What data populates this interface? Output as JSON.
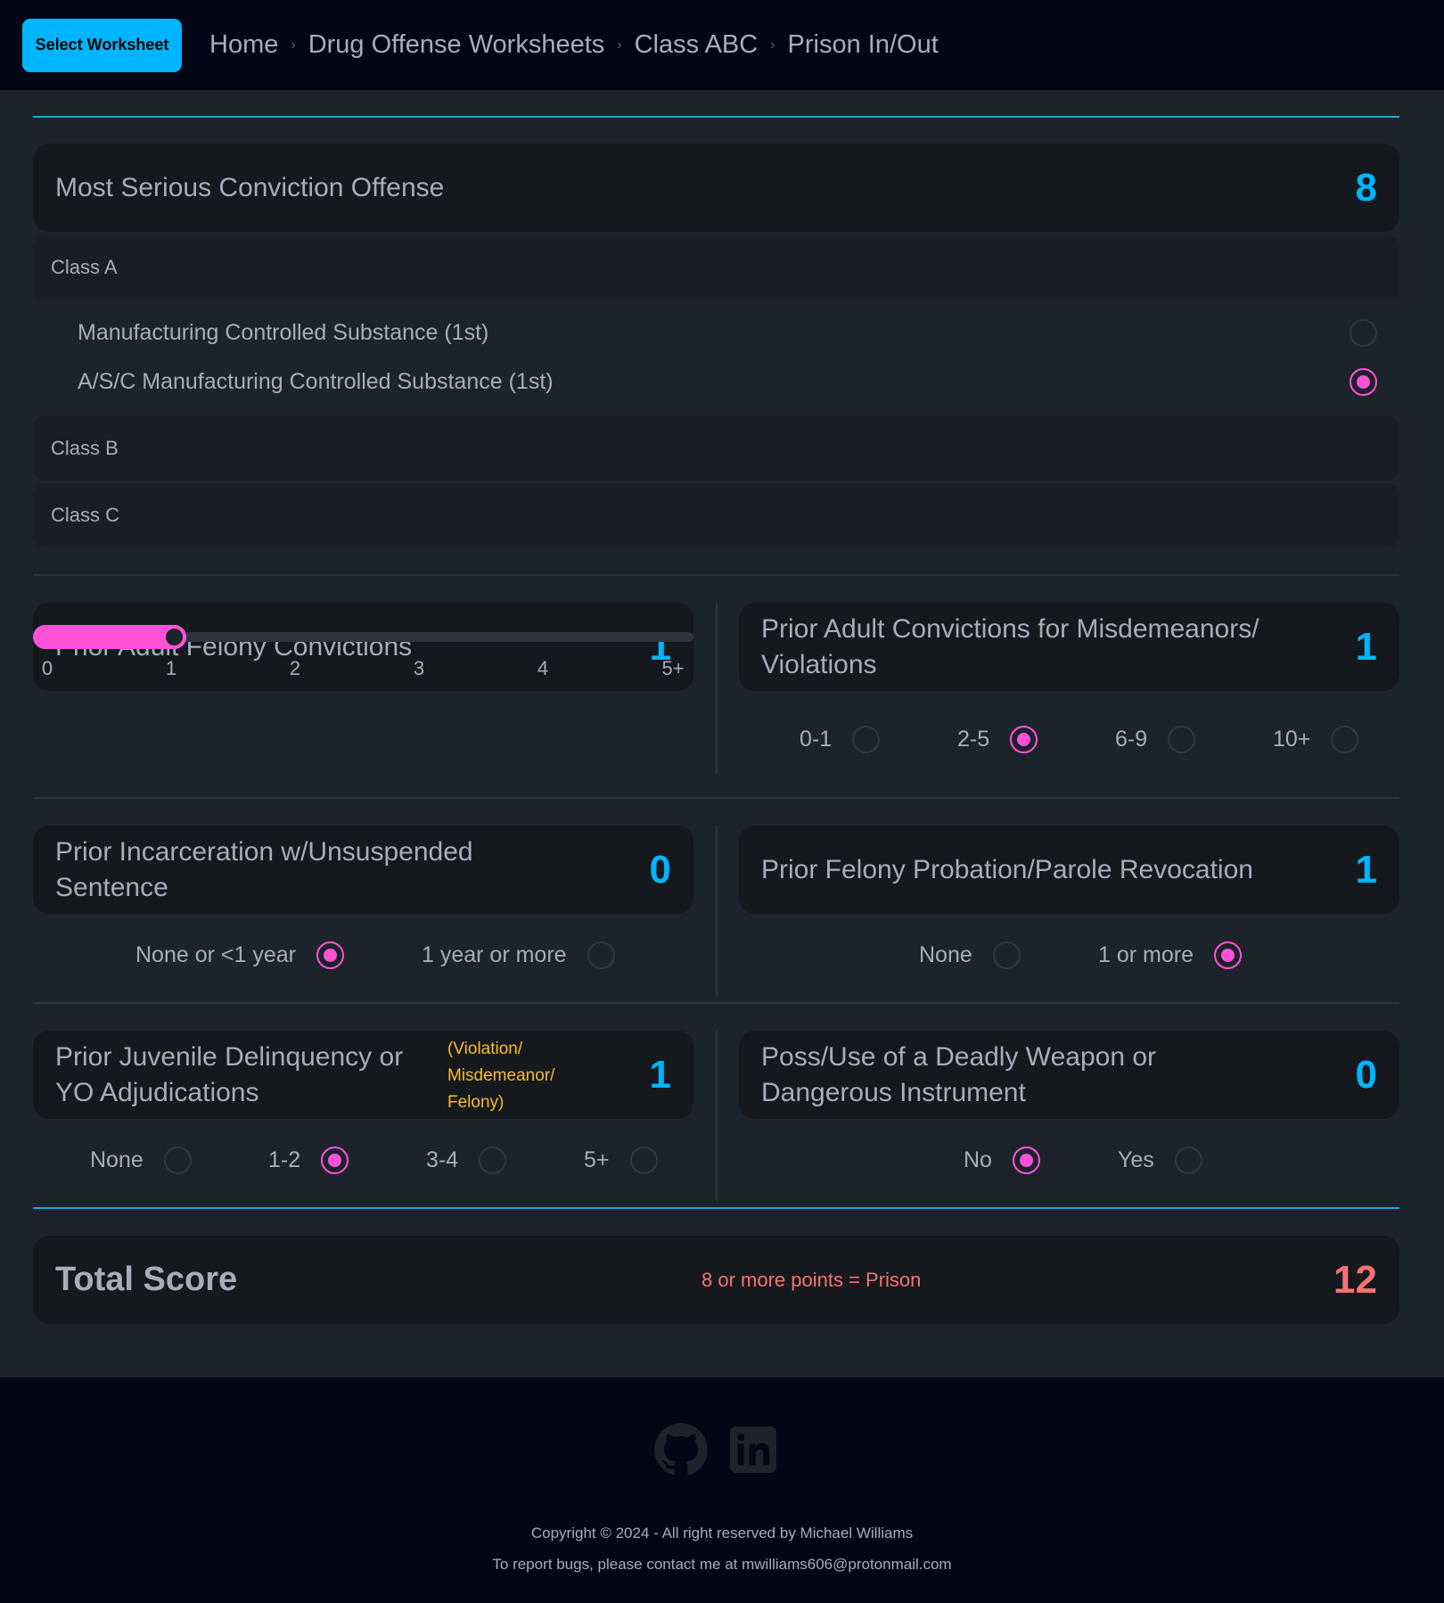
{
  "nav": {
    "select_button": "Select Worksheet",
    "breadcrumbs": [
      "Home",
      "Drug Offense Worksheets",
      "Class ABC",
      "Prison In/Out"
    ]
  },
  "offense": {
    "title": "Most Serious Conviction Offense",
    "score": "8",
    "classes": [
      {
        "label": "Class A",
        "options": [
          {
            "label": "Manufacturing Controlled Substance (1st)",
            "selected": false
          },
          {
            "label": "A/S/C Manufacturing Controlled Substance (1st)",
            "selected": true
          }
        ]
      },
      {
        "label": "Class B"
      },
      {
        "label": "Class C"
      }
    ]
  },
  "felony": {
    "title": "Prior Adult Felony Convictions",
    "score": "1",
    "ticks": [
      "0",
      "1",
      "2",
      "3",
      "4",
      "5+"
    ],
    "value_index": 1
  },
  "misdemeanor": {
    "title": "Prior Adult Convictions for Misdemeanors/ Violations",
    "score": "1",
    "options": [
      "0-1",
      "2-5",
      "6-9",
      "10+"
    ],
    "selected": "2-5"
  },
  "incarceration": {
    "title": "Prior Incarceration w/Unsuspended Sentence",
    "score": "0",
    "options": [
      "None or <1 year",
      "1 year or more"
    ],
    "selected": "None or <1 year"
  },
  "revocation": {
    "title": "Prior Felony Probation/Parole Revocation",
    "score": "1",
    "options": [
      "None",
      "1 or more"
    ],
    "selected": "1 or more"
  },
  "juvenile": {
    "title": "Prior Juvenile Delinquency or YO Adjudications",
    "note": "(Violation/ Misdemeanor/ Felony)",
    "score": "1",
    "options": [
      "None",
      "1-2",
      "3-4",
      "5+"
    ],
    "selected": "1-2"
  },
  "weapon": {
    "title": "Poss/Use of a Deadly Weapon or Dangerous Instrument",
    "score": "0",
    "options": [
      "No",
      "Yes"
    ],
    "selected": "No"
  },
  "total": {
    "label": "Total Score",
    "rule": "8 or more points = Prison",
    "score": "12"
  },
  "footer": {
    "icons": [
      "github-icon",
      "linkedin-icon"
    ],
    "copyright": "Copyright © 2024 - All right reserved by Michael Williams",
    "bugs": "To report bugs, please contact me at mwilliams606@protonmail.com"
  },
  "colors": {
    "accent": "#00b5ff",
    "selected": "#ff52d9",
    "danger": "#f87272",
    "warning": "#fbbd23"
  }
}
